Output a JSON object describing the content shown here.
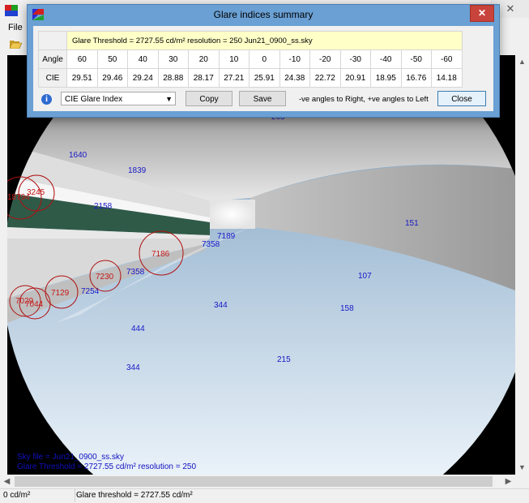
{
  "main": {
    "menu_file": "File",
    "status_left": "0 cd/m²",
    "status_right": "Glare threshold = 2727.55 cd/m²"
  },
  "overlay": {
    "sky_file": "Sky file = Jun21_0900_ss.sky",
    "threshold": "Glare Threshold = 2727.55 cd/m²  resolution = 250"
  },
  "points": {
    "p1640": "1640",
    "p1839": "1839",
    "p2158": "2158",
    "p265": "265",
    "p151": "151",
    "p7189": "7189",
    "p7358a": "7358",
    "p107": "107",
    "p7358b": "7358",
    "p7254": "7254",
    "p344a": "344",
    "p158": "158",
    "p444": "444",
    "p215": "215",
    "p344b": "344"
  },
  "glare_sources": {
    "g1": "18794",
    "g2": "3245",
    "g3": "7186",
    "g4": "7230",
    "g5": "7129",
    "g6": "7029",
    "g7": "7044"
  },
  "dialog": {
    "title": "Glare indices summary",
    "info_line": "Glare Threshold = 2727.55 cd/m²    resolution = 250    Jun21_0900_ss.sky",
    "row1_label": "Angle",
    "row2_label": "CIE",
    "angles": [
      "60",
      "50",
      "40",
      "30",
      "20",
      "10",
      "0",
      "-10",
      "-20",
      "-30",
      "-40",
      "-50",
      "-60"
    ],
    "cie_values": [
      "29.51",
      "29.46",
      "29.24",
      "28.88",
      "28.17",
      "27.21",
      "25.91",
      "24.38",
      "22.72",
      "20.91",
      "18.95",
      "16.76",
      "14.18"
    ],
    "select_value": "CIE Glare Index",
    "copy_label": "Copy",
    "save_label": "Save",
    "angle_note": "-ve angles to Right, +ve angles to Left",
    "close_label": "Close"
  },
  "colors": {
    "point_text": "#1818c8",
    "glare_text": "#c81818",
    "dialog_frame": "#6aa0d4",
    "info_row": "#ffffc8",
    "close_red": "#c8433b"
  }
}
